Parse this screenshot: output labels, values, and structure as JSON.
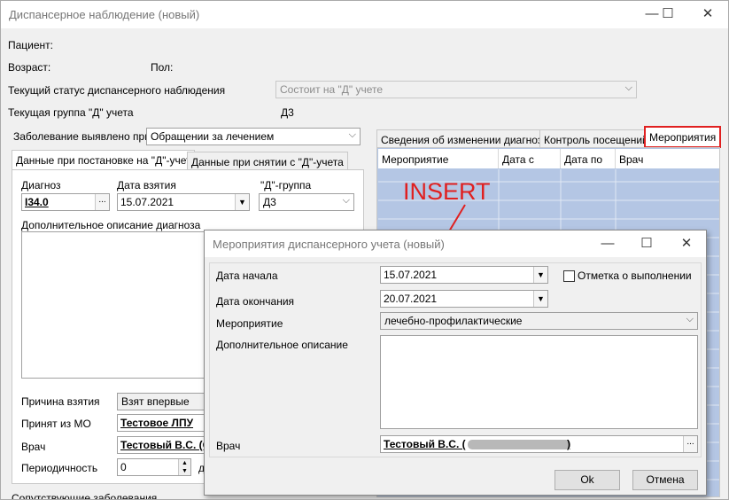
{
  "main": {
    "title": "Диспансерное наблюдение (новый)",
    "controls": {
      "minimize": "—",
      "maximize": "☐",
      "close": "✕"
    },
    "patient_label": "Пациент:",
    "age_label": "Возраст:",
    "sex_label": "Пол:",
    "status_label": "Текущий статус диспансерного наблюдения",
    "status_value": "Состоит на \"Д\" учете",
    "group_label": "Текущая группа \"Д\" учета",
    "group_value": "Д3",
    "detected_label": "Заболевание выявлено при",
    "detected_value": "Обращении за лечением",
    "tabs_left": [
      "Данные при постановке на \"Д\"-учет",
      "Данные при снятии с \"Д\"-учета"
    ],
    "diagnosis_label": "Диагноз",
    "diagnosis_value": "I34.0",
    "date_taken_label": "Дата взятия",
    "date_taken_value": "15.07.2021",
    "dgroup_label": "\"Д\"-группа",
    "dgroup_value": "Д3",
    "extra_desc_label": "Дополнительное описание диагноза",
    "reason_label": "Причина взятия",
    "reason_value": "Взят впервые",
    "from_mo_label": "Принят из МО",
    "from_mo_value": "Тестовое ЛПУ",
    "doctor_label": "Врач",
    "doctor_value": "Тестовый В.С. (С",
    "periodicity_label": "Периодичность",
    "periodicity_value": "0",
    "periodicity_unit": "д",
    "concomitant_label": "Сопутствующие заболевания",
    "tabs_right": [
      "Сведения об изменении диагноза",
      "Контроль посещений",
      "Мероприятия"
    ],
    "grid_columns": [
      "Мероприятие",
      "Дата с",
      "Дата по",
      "Врач"
    ],
    "browse": "..."
  },
  "annotation": {
    "text": "INSERT",
    "color": "#e02020"
  },
  "dialog": {
    "title": "Мероприятия диспансерного учета (новый)",
    "start_label": "Дата начала",
    "start_value": "15.07.2021",
    "end_label": "Дата окончания",
    "end_value": "20.07.2021",
    "done_label": "Отметка о выполнении",
    "event_label": "Мероприятие",
    "event_value": "лечебно-профилактические",
    "desc_label": "Дополнительное описание",
    "doctor_label": "Врач",
    "doctor_value_prefix": "Тестовый В.С. (",
    "doctor_value_suffix": ")",
    "browse": "...",
    "ok": "Ok",
    "cancel": "Отмена"
  },
  "colors": {
    "grid_fill": "#b4c6e4",
    "highlight": "#e02020"
  }
}
